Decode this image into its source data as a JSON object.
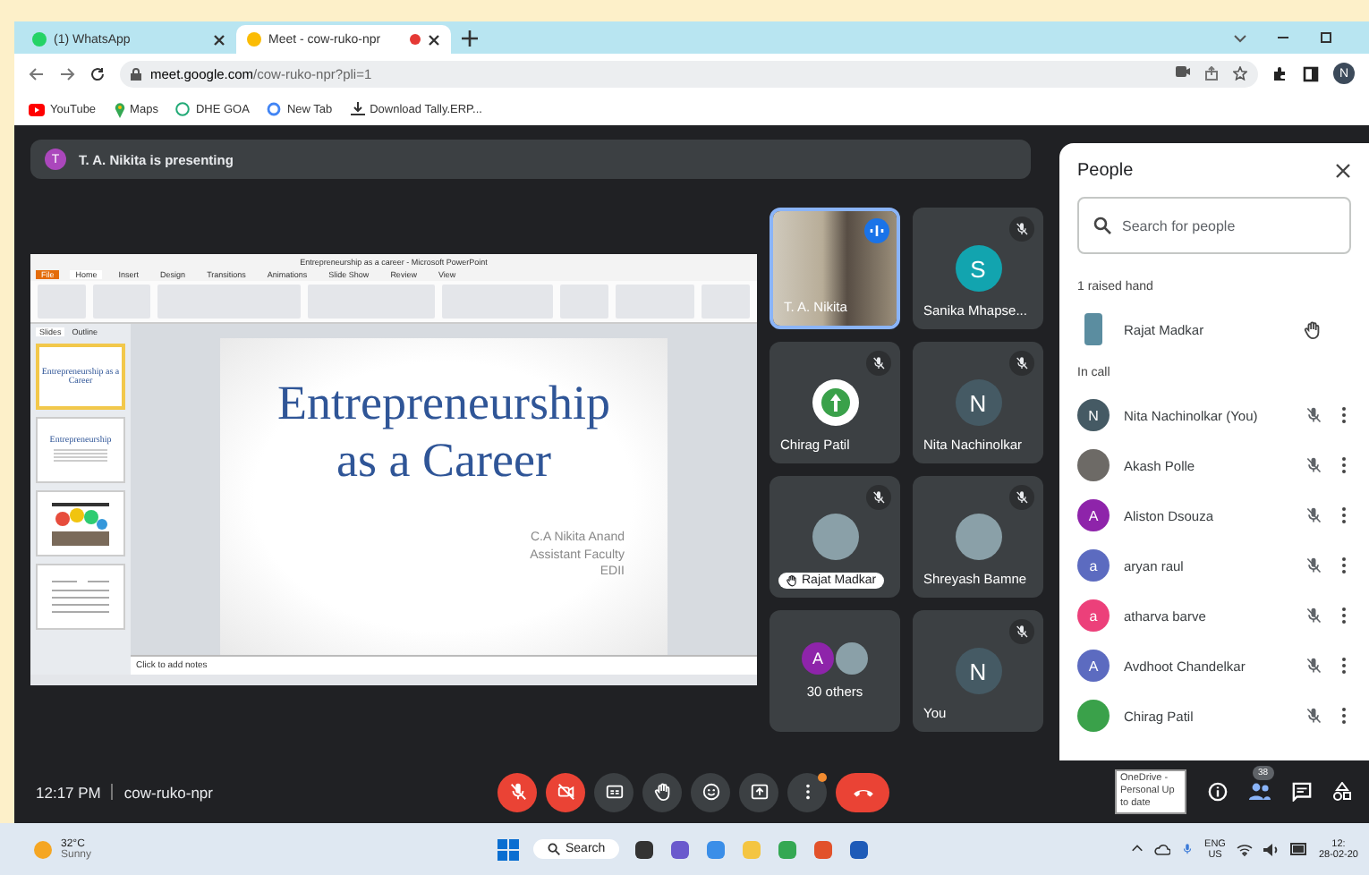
{
  "browser": {
    "tabs": [
      {
        "title": "(1) WhatsApp",
        "selected": false,
        "recording": false
      },
      {
        "title": "Meet - cow-ruko-npr",
        "selected": true,
        "recording": true
      }
    ],
    "url_domain": "meet.google.com",
    "url_path": "/cow-ruko-npr?pli=1",
    "profile": "N",
    "bookmarks": [
      {
        "label": "YouTube",
        "kind": "video"
      },
      {
        "label": "Maps",
        "kind": "pin"
      },
      {
        "label": "DHE GOA",
        "kind": "globe"
      },
      {
        "label": "New Tab",
        "kind": "search"
      },
      {
        "label": "Download Tally.ERP...",
        "kind": "download"
      }
    ]
  },
  "meet": {
    "presenting": {
      "initial": "T",
      "text": "T. A. Nikita is presenting"
    },
    "slide_window": {
      "title": "Entrepreneurship as a career - Microsoft PowerPoint",
      "ribbon_tabs": [
        {
          "label": "File",
          "kind": "file",
          "selected": false
        },
        {
          "label": "Home",
          "kind": "tab",
          "selected": true
        },
        {
          "label": "Insert",
          "kind": "tab",
          "selected": false
        },
        {
          "label": "Design",
          "kind": "tab",
          "selected": false
        },
        {
          "label": "Transitions",
          "kind": "tab",
          "selected": false
        },
        {
          "label": "Animations",
          "kind": "tab",
          "selected": false
        },
        {
          "label": "Slide Show",
          "kind": "tab",
          "selected": false
        },
        {
          "label": "Review",
          "kind": "tab",
          "selected": false
        },
        {
          "label": "View",
          "kind": "tab",
          "selected": false
        }
      ],
      "pane_tabs": [
        {
          "label": "Slides",
          "selected": true
        },
        {
          "label": "Outline",
          "selected": false
        }
      ],
      "thumbnails": [
        {
          "kind": "title",
          "text": "Entrepreneurship as a Career",
          "selected": true
        },
        {
          "kind": "text",
          "text": "Entrepreneurship",
          "selected": false
        },
        {
          "kind": "image",
          "selected": false
        },
        {
          "kind": "table",
          "selected": false
        }
      ],
      "slide": {
        "title_lines": [
          "Entrepreneurship",
          "as a Career"
        ],
        "author_lines": [
          "C.A Nikita Anand",
          "Assistant Faculty",
          "EDII"
        ]
      },
      "notes": "Click to add notes"
    },
    "tiles": [
      {
        "name": "T. A. Nikita",
        "kind": "video",
        "speaking": true,
        "muted": false,
        "hand_raised": false
      },
      {
        "name": "Sanika Mhapse...",
        "kind": "letter",
        "letter": "S",
        "color": "#12a4af",
        "speaking": false,
        "muted": true,
        "hand_raised": false
      },
      {
        "name": "Chirag Patil",
        "kind": "logo",
        "speaking": false,
        "muted": true,
        "hand_raised": false
      },
      {
        "name": "Nita Nachinolkar",
        "kind": "letter",
        "letter": "N",
        "color": "#455a64",
        "speaking": false,
        "muted": true,
        "hand_raised": false
      },
      {
        "name": "Rajat Madkar",
        "kind": "photo",
        "speaking": false,
        "muted": true,
        "hand_raised": true
      },
      {
        "name": "Shreyash Bamne",
        "kind": "photo",
        "speaking": false,
        "muted": true,
        "hand_raised": false
      },
      {
        "name": "30 others",
        "kind": "others",
        "letter": "A",
        "color": "#8e24aa",
        "speaking": false,
        "muted": false,
        "hand_raised": false
      },
      {
        "name": "You",
        "kind": "letter",
        "letter": "N",
        "color": "#455a64",
        "speaking": false,
        "muted": true,
        "hand_raised": false
      }
    ],
    "people": {
      "title": "People",
      "search_placeholder": "Search for people",
      "raised_label": "1 raised hand",
      "raised": [
        {
          "name": "Rajat Madkar",
          "kind": "photo"
        }
      ],
      "in_call_label": "In call",
      "in_call": [
        {
          "name": "Nita Nachinolkar (You)",
          "kind": "letter",
          "letter": "N",
          "color": "#455a64",
          "muted": true
        },
        {
          "name": "Akash Polle",
          "kind": "photo",
          "muted": true
        },
        {
          "name": "Aliston Dsouza",
          "kind": "letter",
          "letter": "A",
          "color": "#8e24aa",
          "muted": true
        },
        {
          "name": "aryan raul",
          "kind": "letter",
          "letter": "a",
          "color": "#5c6bc0",
          "muted": true
        },
        {
          "name": "atharva barve",
          "kind": "letter",
          "letter": "a",
          "color": "#ec407a",
          "muted": true
        },
        {
          "name": "Avdhoot Chandelkar",
          "kind": "letter",
          "letter": "A",
          "color": "#5c6bc0",
          "muted": true
        },
        {
          "name": "Chirag Patil",
          "kind": "logo",
          "muted": true
        }
      ]
    },
    "bottom": {
      "time": "12:17 PM",
      "meeting_code": "cow-ruko-npr",
      "controls": [
        {
          "kind": "mic",
          "off": true
        },
        {
          "kind": "camera",
          "off": true
        },
        {
          "kind": "captions",
          "off": false
        },
        {
          "kind": "hand",
          "off": false
        },
        {
          "kind": "emoji",
          "off": false
        },
        {
          "kind": "present",
          "off": false
        },
        {
          "kind": "more",
          "off": false
        },
        {
          "kind": "leave",
          "off": true
        }
      ],
      "tooltip": "OneDrive - Personal Up to date",
      "people_count": "38"
    }
  },
  "taskbar": {
    "temperature": "32°C",
    "weather": "Sunny",
    "search": "Search",
    "lang": "ENG",
    "region": "US",
    "time": "12:",
    "date": "28-02-20"
  }
}
